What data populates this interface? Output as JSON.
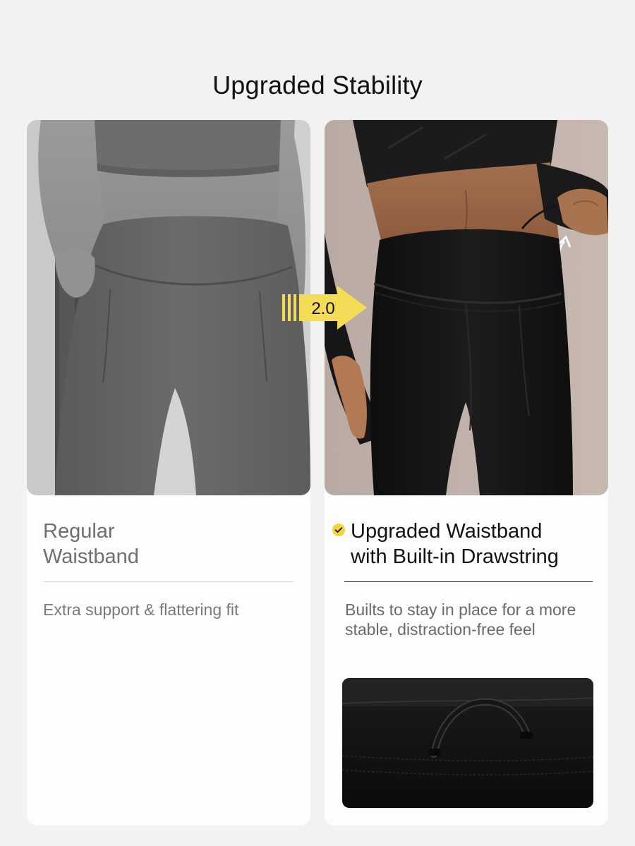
{
  "page_title": "Upgraded Stability",
  "badge": {
    "label": "2.0"
  },
  "colors": {
    "accent": "#f4dc56",
    "check": "#f4d43c"
  },
  "left_card": {
    "heading": "Regular\nWaistband",
    "description": "Extra support & flattering fit",
    "photo_icon": "model-regular-waistband-photo"
  },
  "right_card": {
    "heading": "Upgraded Waistband\nwith Built-in Drawstring",
    "description": "Builts to stay in place for a more\nstable, distraction-free feel",
    "photo_icon": "model-upgraded-waistband-photo",
    "detail_icon": "drawstring-loop-closeup-photo",
    "check_icon": "check-circle-icon"
  }
}
